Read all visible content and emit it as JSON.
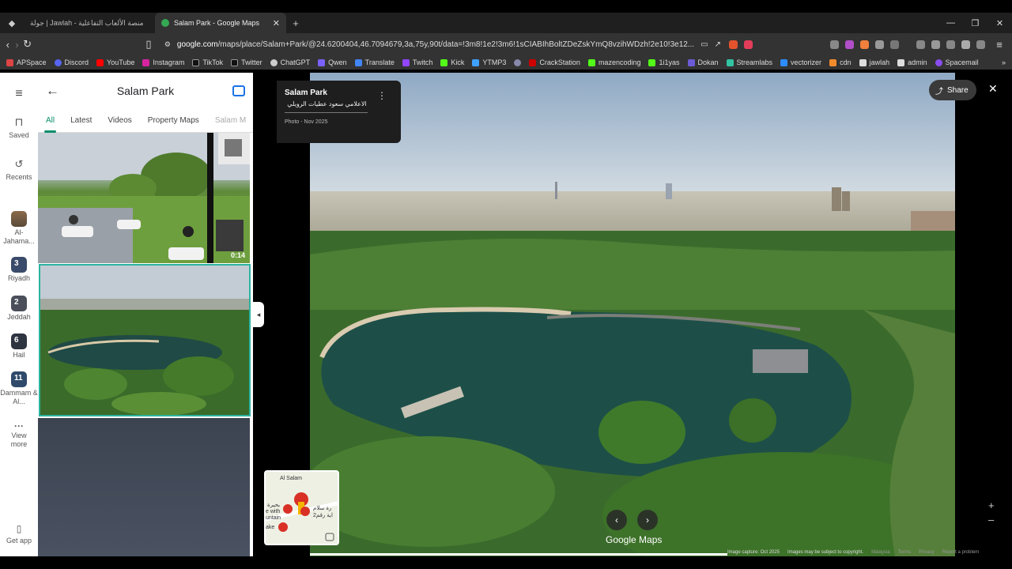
{
  "browser": {
    "tabs": [
      {
        "title": "جولة | Jawlah - منصة الألعاب التفاعلية"
      },
      {
        "title": "Salam Park - Google Maps"
      }
    ],
    "url_host": "google.com",
    "url_rest": "/maps/place/Salam+Park/@24.6200404,46.7094679,3a,75y,90t/data=!3m8!1e2!3m6!1sCIABIhBoltZDeZskYmQ8vzihWDzh!2e10!3e12...",
    "bookmarks": [
      "APSpace",
      "Discord",
      "YouTube",
      "Instagram",
      "TikTok",
      "Twitter",
      "ChatGPT",
      "Qwen",
      "Translate",
      "Twitch",
      "Kick",
      "YTMP3",
      "",
      "CrackStation",
      "mazencoding",
      "1i1yas",
      "Dokan",
      "Streamlabs",
      "vectorizer",
      "cdn",
      "jawlah",
      "admin",
      "Spacemail"
    ]
  },
  "rail": {
    "saved": "Saved",
    "recents": "Recents",
    "places": [
      {
        "label": "Al-Jahama..."
      },
      {
        "label": "Riyadh",
        "badge": "3"
      },
      {
        "label": "Jeddah",
        "badge": "2"
      },
      {
        "label": "Hail",
        "badge": "6"
      },
      {
        "label": "Dammam & Al...",
        "badge": "11"
      }
    ],
    "view_more": "View more",
    "get_app": "Get app"
  },
  "panel": {
    "title": "Salam Park",
    "tabs": [
      "All",
      "Latest",
      "Videos",
      "Property Maps",
      "Salam M"
    ],
    "video_duration": "0:14"
  },
  "viewer": {
    "place_name": "Salam Park",
    "contributor": "الاعلامي سعود عطيات الرويلي",
    "photo_date": "Photo - Nov 2025",
    "share": "Share",
    "logo": "Google Maps",
    "footer": [
      "Image capture: Oct 2025",
      "Images may be subject to copyright.",
      "Malaysia",
      "Terms",
      "Privacy",
      "Report a problem"
    ]
  },
  "minimap": {
    "labels": [
      "Al Salam",
      "بحيرة",
      "e with",
      "untain",
      "ake",
      "رة سلام",
      "اية رقم2"
    ]
  },
  "colors": {
    "accent": "#0b8f6b",
    "selected_border": "#2bb3a1"
  }
}
